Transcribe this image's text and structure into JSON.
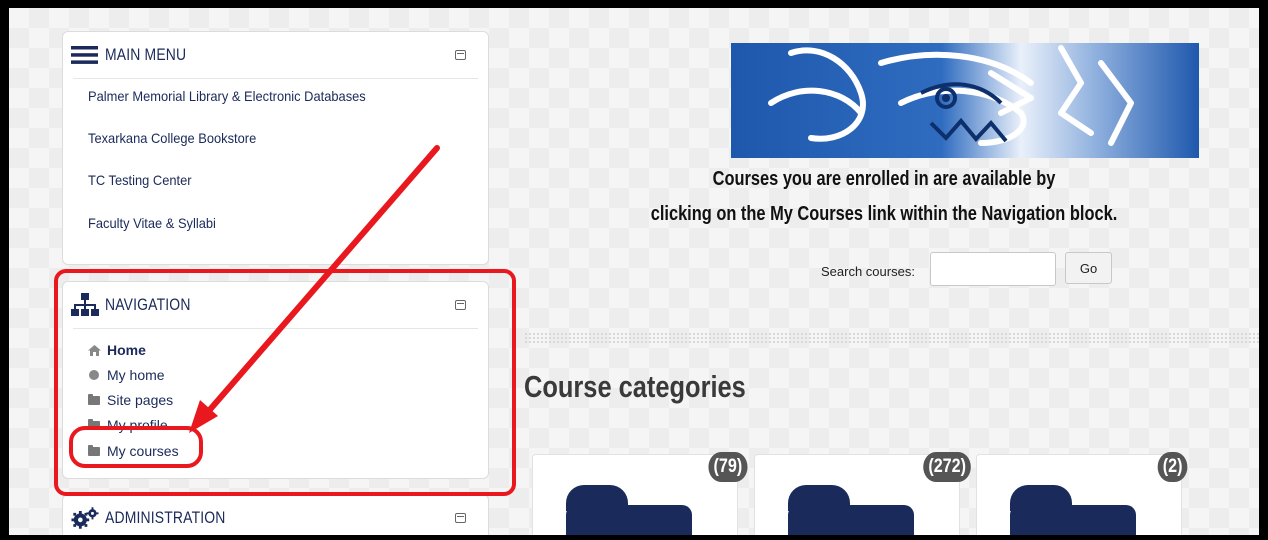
{
  "main_menu": {
    "title": "MAIN MENU",
    "links": [
      "Palmer Memorial Library & Electronic Databases",
      "Texarkana College Bookstore",
      "TC Testing Center",
      "Faculty Vitae & Syllabi"
    ]
  },
  "navigation": {
    "title": "NAVIGATION",
    "items": [
      {
        "label": "Home",
        "icon": "home-icon"
      },
      {
        "label": "My home",
        "icon": "circle-icon"
      },
      {
        "label": "Site pages",
        "icon": "folder-icon"
      },
      {
        "label": "My profile",
        "icon": "folder-icon"
      },
      {
        "label": "My courses",
        "icon": "folder-icon"
      }
    ]
  },
  "administration": {
    "title": "ADMINISTRATION"
  },
  "intro": {
    "line1": "Courses you are enrolled in are available by",
    "line2": "clicking on the My Courses link within the Navigation block."
  },
  "search": {
    "label": "Search courses:",
    "value": "",
    "button": "Go"
  },
  "categories": {
    "heading": "Course categories",
    "items": [
      {
        "count": "(79)"
      },
      {
        "count": "(272)"
      },
      {
        "count": "(2)"
      }
    ]
  },
  "colors": {
    "navy": "#1a2a5a",
    "highlight_red": "#e8181e",
    "banner_blue": "#1d5bb0"
  }
}
